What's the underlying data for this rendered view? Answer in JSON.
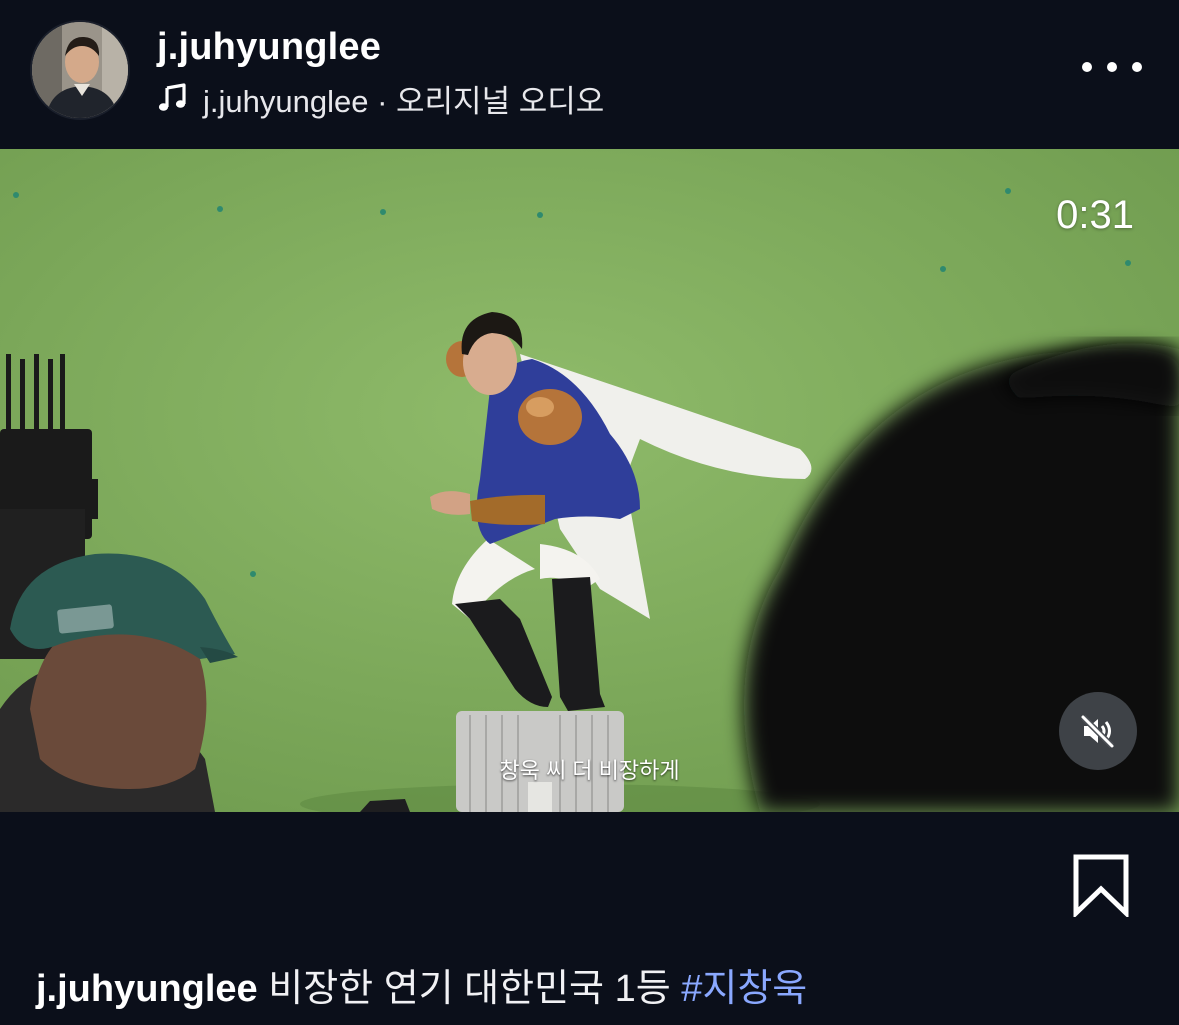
{
  "header": {
    "username": "j.juhyunglee",
    "audio_label": "j.juhyunglee · 오리지널 오디오",
    "more_icon": "more-horizontal-icon"
  },
  "video": {
    "timer": "0:31",
    "subtitle": "창욱 씨 더 비장하게",
    "muted": true,
    "mute_icon": "speaker-muted-icon",
    "background_color": "#7da85a"
  },
  "actions": {
    "bookmark_icon": "bookmark-icon"
  },
  "caption": {
    "username": "j.juhyunglee",
    "text": " 비장한 연기 대한민국 1등 ",
    "hashtag": "#지창욱",
    "hashtag_color": "#8aa8ff"
  }
}
